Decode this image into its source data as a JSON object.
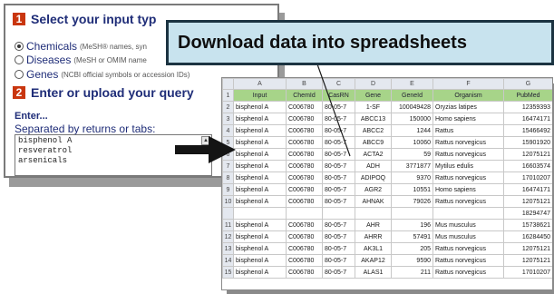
{
  "callout": {
    "text": "Download data into spreadsheets"
  },
  "query_form": {
    "step1": {
      "number": "1",
      "title": "Select your input typ"
    },
    "options": [
      {
        "label": "Chemicals",
        "hint": "(MeSH® names, syn",
        "checked": true
      },
      {
        "label": "Diseases",
        "hint": "(MeSH or OMIM name",
        "checked": false
      },
      {
        "label": "Genes",
        "hint": "(NCBI official symbols or accession IDs)",
        "checked": false
      }
    ],
    "step2": {
      "number": "2",
      "title": "Enter or upload your query"
    },
    "enter_title": "Enter...",
    "enter_hint": "Separated by returns or tabs:",
    "query_lines": [
      "bisphenol A",
      "resveratrol",
      "arsenicals"
    ],
    "scroll_icon": "▲"
  },
  "spreadsheet": {
    "column_letters": [
      "A",
      "B",
      "C",
      "D",
      "E",
      "F",
      "G"
    ],
    "header_cells": [
      "Input",
      "ChemId",
      "CasRN",
      "Gene",
      "GeneId",
      "Organism",
      "PubMed"
    ],
    "rows": [
      {
        "n": "2",
        "cells": [
          "bisphenol A",
          "C006780",
          "80-05-7",
          "1-SF",
          "100049428",
          "Oryzias latipes",
          "12359393"
        ]
      },
      {
        "n": "3",
        "cells": [
          "bisphenol A",
          "C006780",
          "80-05-7",
          "ABCC13",
          "150000",
          "Homo sapiens",
          "16474171"
        ]
      },
      {
        "n": "4",
        "cells": [
          "bisphenol A",
          "C006780",
          "80-05-7",
          "ABCC2",
          "1244",
          "Rattus",
          "15466492"
        ]
      },
      {
        "n": "5",
        "cells": [
          "bisphenol A",
          "C006780",
          "80-05-7",
          "ABCC9",
          "10060",
          "Rattus norvegicus",
          "15901920"
        ]
      },
      {
        "n": "6",
        "cells": [
          "bisphenol A",
          "C006780",
          "80-05-7",
          "ACTA2",
          "59",
          "Rattus norvegicus",
          "12075121"
        ]
      },
      {
        "n": "7",
        "cells": [
          "bisphenol A",
          "C006780",
          "80-05-7",
          "ADH",
          "3771877",
          "Mytilus edulis",
          "16603574"
        ]
      },
      {
        "n": "8",
        "cells": [
          "bisphenol A",
          "C006780",
          "80-05-7",
          "ADIPOQ",
          "9370",
          "Rattus norvegicus",
          "17010207"
        ]
      },
      {
        "n": "9",
        "cells": [
          "bisphenol A",
          "C006780",
          "80-05-7",
          "AGR2",
          "10551",
          "Homo sapiens",
          "16474171"
        ]
      },
      {
        "n": "10",
        "cells": [
          "bisphenol A",
          "C006780",
          "80-05-7",
          "AHNAK",
          "79026",
          "Rattus norvegicus",
          "12075121"
        ]
      },
      {
        "n": "",
        "cells": [
          "",
          "",
          "",
          "",
          "",
          "",
          "18294747"
        ]
      },
      {
        "n": "11",
        "cells": [
          "bisphenol A",
          "C006780",
          "80-05-7",
          "AHR",
          "196",
          "Mus musculus",
          "15738621"
        ]
      },
      {
        "n": "12",
        "cells": [
          "bisphenol A",
          "C006780",
          "80-05-7",
          "AHRR",
          "57491",
          "Mus musculus",
          "16284450"
        ]
      },
      {
        "n": "13",
        "cells": [
          "bisphenol A",
          "C006780",
          "80-05-7",
          "AK3L1",
          "205",
          "Rattus norvegicus",
          "12075121"
        ]
      },
      {
        "n": "14",
        "cells": [
          "bisphenol A",
          "C006780",
          "80-05-7",
          "AKAP12",
          "9590",
          "Rattus norvegicus",
          "12075121"
        ]
      },
      {
        "n": "15",
        "cells": [
          "bisphenol A",
          "C006780",
          "80-05-7",
          "ALAS1",
          "211",
          "Rattus norvegicus",
          "17010207"
        ]
      }
    ]
  },
  "colors": {
    "step_badge": "#c9360f",
    "form_text": "#1f2d78",
    "callout_bg": "#c8e3ee",
    "header_row": "#a7d489"
  }
}
